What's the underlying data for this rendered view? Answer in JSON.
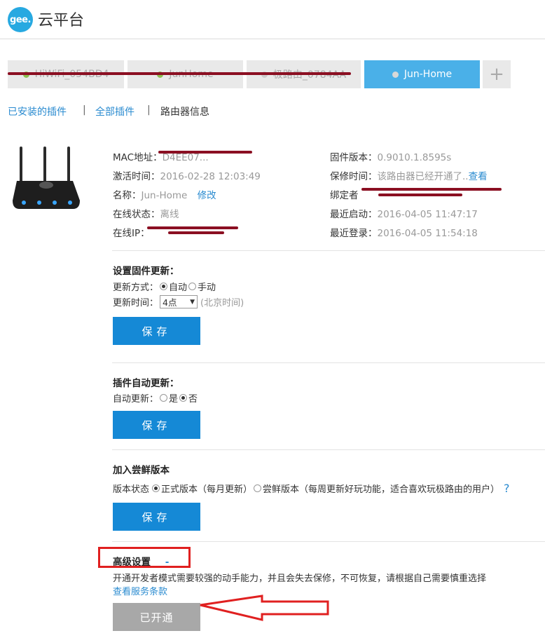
{
  "header": {
    "logo_mark": "gee.",
    "title": "云平台"
  },
  "tabs": [
    {
      "label": "HiWiFi_054BD4",
      "status": "online",
      "redacted": true
    },
    {
      "label": "JunHome",
      "status": "online",
      "redacted": true
    },
    {
      "label": "极路由_0784AA",
      "status": "online",
      "redacted": true
    },
    {
      "label": "Jun-Home",
      "status": "current",
      "redacted": false
    }
  ],
  "tab_add": "+",
  "subnav": {
    "installed": "已安装的插件",
    "all": "全部插件",
    "info": "路由器信息",
    "sep": "|"
  },
  "router_icon": "router-icon",
  "info": {
    "mac_label": "MAC地址：",
    "mac_value": "D4EE07...",
    "activate_label": "激活时间：",
    "activate_value": "2016-02-28 12:03:49",
    "name_label": "名称：",
    "name_value": "Jun-Home",
    "name_edit": "修改",
    "online_label": "在线状态：",
    "online_value": "离线",
    "ip_label": "在线IP：",
    "firmware_label": "固件版本：",
    "firmware_value": "0.9010.1.8595s",
    "warranty_label": "保修时间：",
    "warranty_value": "该路由器已经开通了..",
    "warranty_link": "查看",
    "binder_label": "绑定者",
    "last_boot_label": "最近启动：",
    "last_boot_value": "2016-04-05 11:47:17",
    "last_login_label": "最近登录：",
    "last_login_value": "2016-04-05 11:54:18"
  },
  "firmware_update": {
    "title": "设置固件更新：",
    "mode_label": "更新方式：",
    "mode_auto": "自动",
    "mode_manual": "手动",
    "time_label": "更新时间：",
    "time_value": "4点",
    "timezone": "(北京时间)",
    "save": "保存"
  },
  "plugin_update": {
    "title": "插件自动更新：",
    "label": "自动更新：",
    "yes": "是",
    "no": "否",
    "save": "保存"
  },
  "beta": {
    "title": "加入尝鲜版本",
    "label": "版本状态",
    "stable": "正式版本（每月更新）",
    "beta": "尝鲜版本（每周更新好玩功能，适合喜欢玩极路由的用户）",
    "help": "?",
    "save": "保存"
  },
  "advanced": {
    "title": "高级设置",
    "toggle": "-",
    "desc": "开通开发者模式需要较强的动手能力，并且会失去保修，不可恢复，请根据自己需要慎重选择",
    "terms_link": "查看服务条款",
    "button": "已开通"
  },
  "colors": {
    "accent": "#1589d6",
    "tab_active": "#4ab0e8",
    "annotation": "#e02020",
    "redaction": "#8b0f22"
  }
}
